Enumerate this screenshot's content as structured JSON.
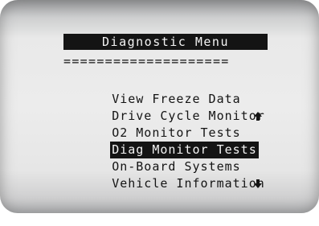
{
  "menu": {
    "title": "Diagnostic Menu",
    "separator": "====================",
    "items": [
      {
        "label": "View Freeze Data",
        "selected": false
      },
      {
        "label": "Drive Cycle Monitor",
        "selected": false
      },
      {
        "label": "O2 Monitor Tests",
        "selected": false
      },
      {
        "label": "Diag Monitor Tests",
        "selected": true
      },
      {
        "label": "On-Board Systems",
        "selected": false
      },
      {
        "label": "Vehicle Information",
        "selected": false
      }
    ]
  },
  "icons": {
    "scroll_up": "arrow-up-icon",
    "scroll_down": "arrow-down-icon"
  },
  "colors": {
    "highlight": "#141414",
    "highlight_text": "#f4f4f4"
  }
}
